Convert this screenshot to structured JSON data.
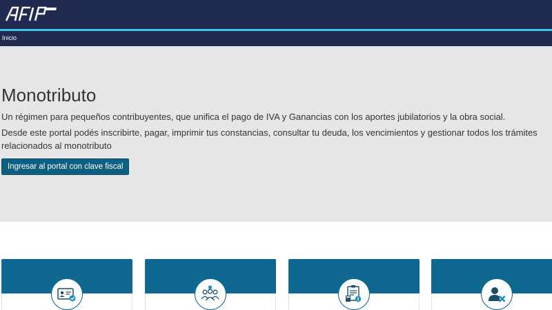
{
  "header": {
    "logo_text": "AFIP",
    "logo_icon": "afip-logo",
    "accent_line_color": "#3ec7e5",
    "background_color": "#212b51"
  },
  "breadcrumb": {
    "items": [
      {
        "label": "Inicio"
      }
    ]
  },
  "hero": {
    "title": "Monotributo",
    "description_1": "Un régimen para pequeños contribuyentes, que unifica el pago de IVA y Ganancias con los aportes jubilatorios y la obra social.",
    "description_2": "Desde este portal podés inscribirte, pagar, imprimir tus constancias, consultar tu deuda, los vencimientos y gestionar todos los trámites relacionados al monotributo",
    "button_label": "Ingresar al portal con clave fiscal",
    "background_color": "#e6e6e6",
    "button_color": "#0e5f80"
  },
  "cards": [
    {
      "icon": "id-card-check-icon"
    },
    {
      "icon": "people-group-icon"
    },
    {
      "icon": "document-calculator-icon"
    },
    {
      "icon": "user-remove-icon"
    }
  ],
  "card_color": "#0e6890"
}
